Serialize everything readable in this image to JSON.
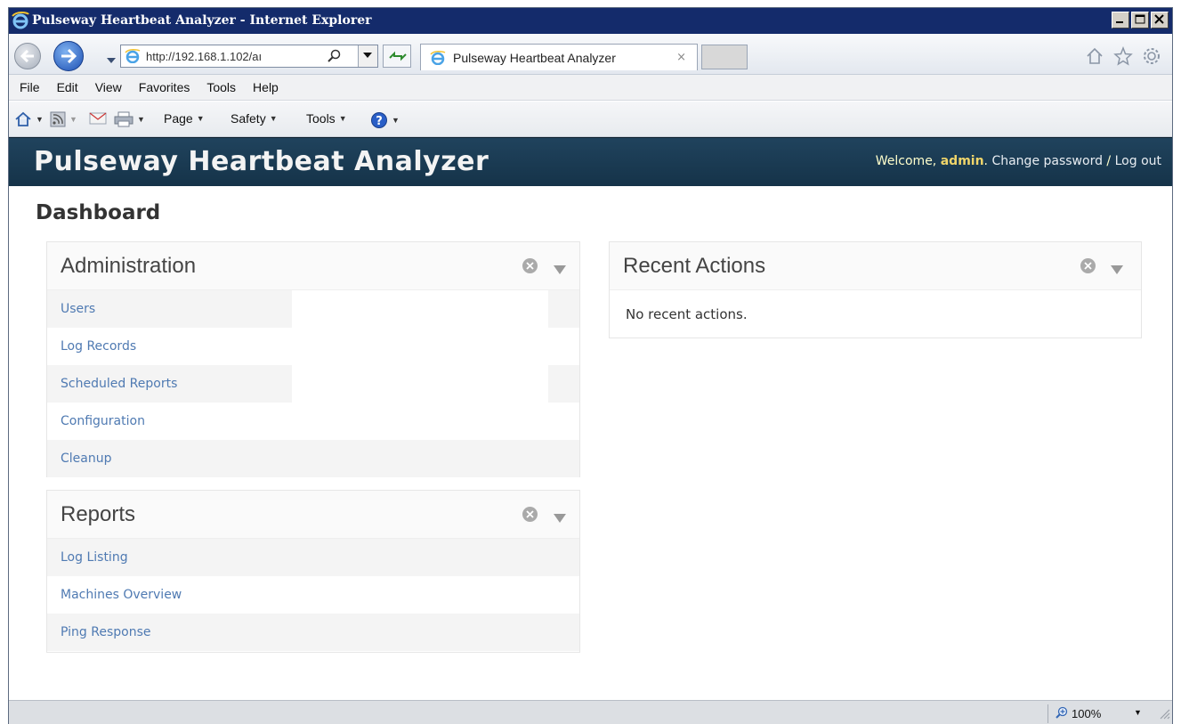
{
  "window": {
    "title": "Pulseway Heartbeat Analyzer - Internet Explorer"
  },
  "nav": {
    "address": "http://192.168.1.102/aı",
    "tab_label": "Pulseway Heartbeat Analyzer",
    "tab_close": "×"
  },
  "menu": {
    "items": [
      "File",
      "Edit",
      "View",
      "Favorites",
      "Tools",
      "Help"
    ]
  },
  "commands": {
    "page": "Page",
    "safety": "Safety",
    "tools": "Tools"
  },
  "app": {
    "title": "Pulseway Heartbeat Analyzer",
    "welcome": "Welcome, ",
    "username": "admin",
    "dot": ".",
    "change_password": "Change password",
    "sep": " / ",
    "logout": "Log out"
  },
  "page_title": "Dashboard",
  "modules": {
    "administration": {
      "title": "Administration",
      "links": [
        "Users",
        "Log Records",
        "Scheduled Reports",
        "Configuration",
        "Cleanup"
      ]
    },
    "reports": {
      "title": "Reports",
      "links": [
        "Log Listing",
        "Machines Overview",
        "Ping Response"
      ]
    },
    "recent_actions": {
      "title": "Recent Actions",
      "empty_message": "No recent actions."
    }
  },
  "status": {
    "zoom": "100%"
  },
  "colors": {
    "titlebar": "#142b6b",
    "header": "#1b3c54",
    "link": "#4f7ab2",
    "username": "#f0d56a"
  }
}
